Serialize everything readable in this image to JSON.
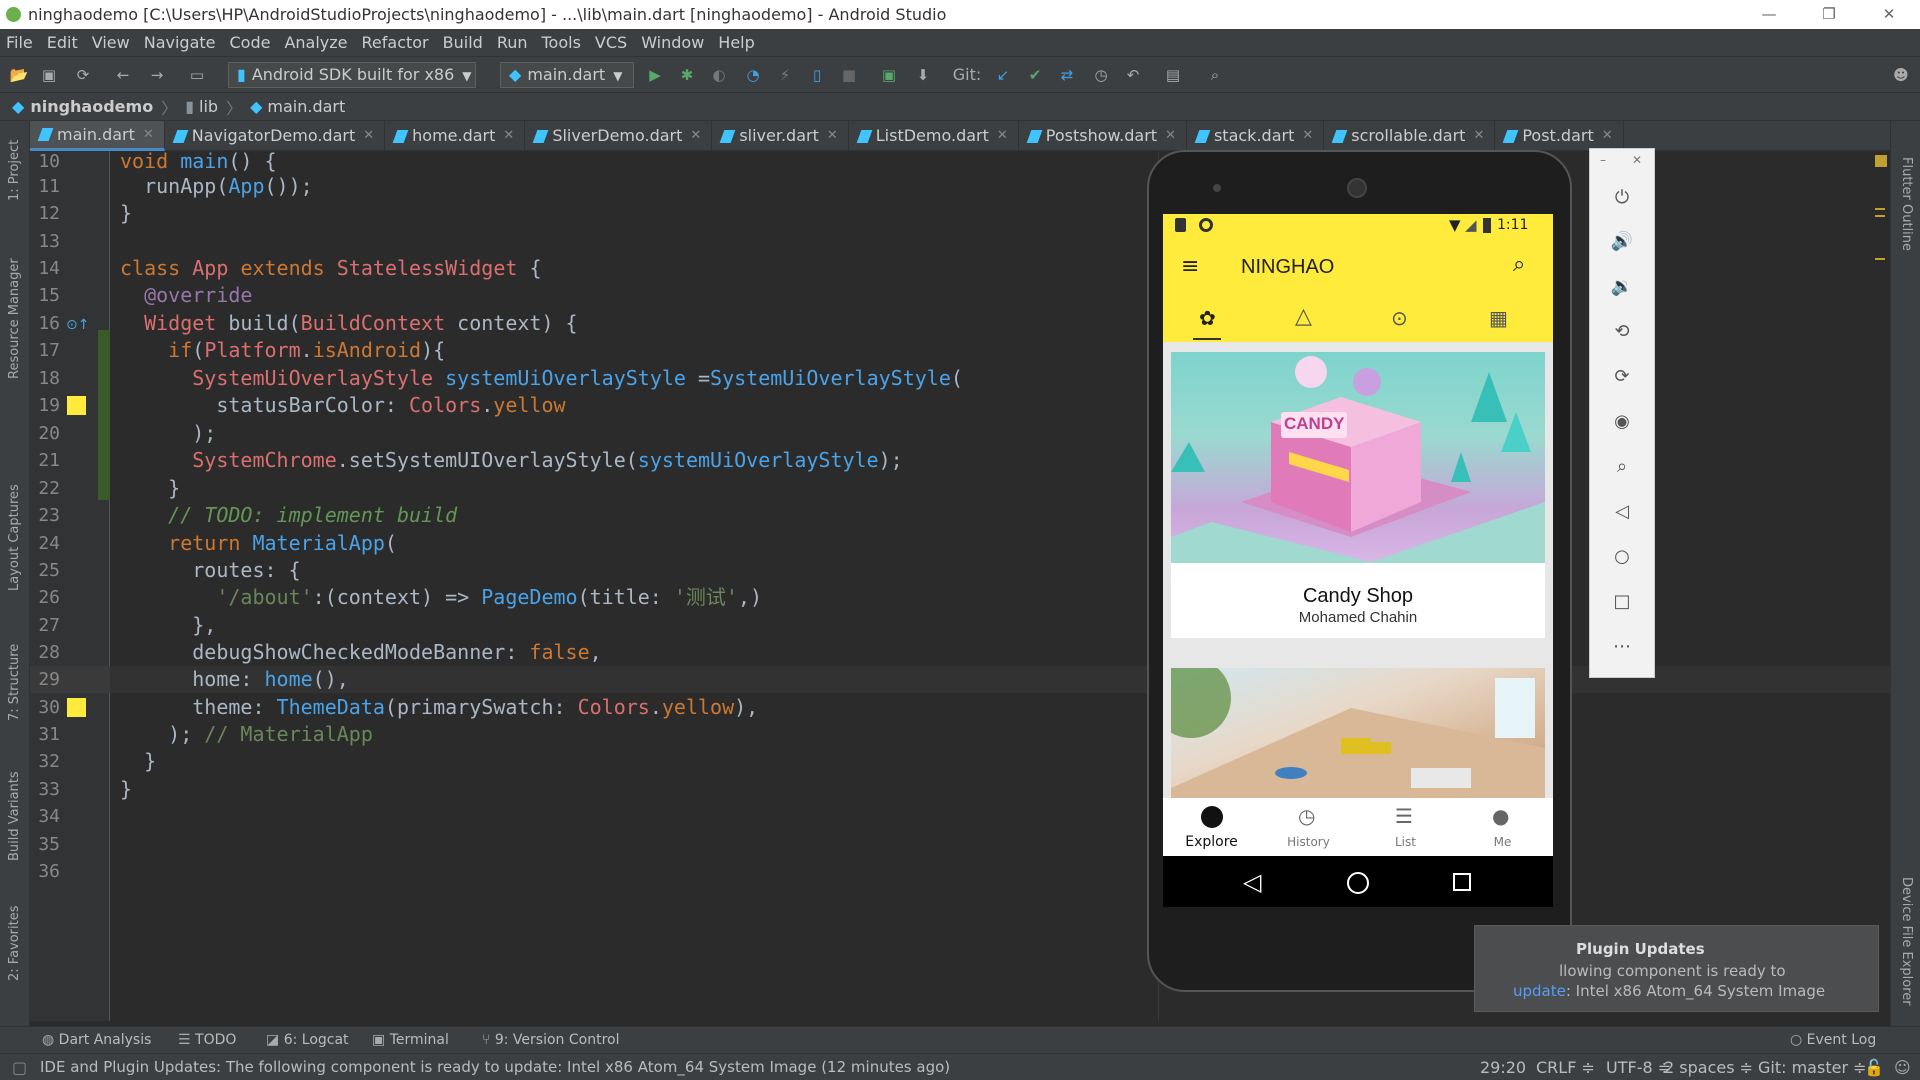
{
  "window": {
    "title": "ninghaodemo [C:\\Users\\HP\\AndroidStudioProjects\\ninghaodemo] - ...\\lib\\main.dart [ninghaodemo] - Android Studio",
    "minimize": "—",
    "maximize": "❐",
    "close": "✕"
  },
  "menu": [
    "File",
    "Edit",
    "View",
    "Navigate",
    "Code",
    "Analyze",
    "Refactor",
    "Build",
    "Run",
    "Tools",
    "VCS",
    "Window",
    "Help"
  ],
  "toolbar": {
    "device": "Android SDK built for x86",
    "run_config": "main.dart",
    "git_label": "Git:"
  },
  "breadcrumb": [
    "ninghaodemo",
    "lib",
    "main.dart"
  ],
  "tabs": [
    "main.dart",
    "NavigatorDemo.dart",
    "home.dart",
    "SliverDemo.dart",
    "sliver.dart",
    "ListDemo.dart",
    "Postshow.dart",
    "stack.dart",
    "scrollable.dart",
    "Post.dart"
  ],
  "left_tools": [
    "1: Project",
    "Resource Manager",
    "Layout Captures",
    "7: Structure",
    "Build Variants",
    "2: Favorites"
  ],
  "right_tools": [
    "Flutter Outline",
    "Device File Explorer"
  ],
  "code_lines": [
    {
      "n": "10",
      "text": "void main() {"
    },
    {
      "n": "11",
      "text": "  runApp(App());"
    },
    {
      "n": "12",
      "text": "}"
    },
    {
      "n": "13",
      "text": ""
    },
    {
      "n": "14",
      "text": "class App extends StatelessWidget {"
    },
    {
      "n": "15",
      "text": "  @override"
    },
    {
      "n": "16",
      "text": "  Widget build(BuildContext context) {"
    },
    {
      "n": "17",
      "text": "    if(Platform.isAndroid){"
    },
    {
      "n": "18",
      "text": "      SystemUiOverlayStyle systemUiOverlayStyle =SystemUiOverlayStyle("
    },
    {
      "n": "19",
      "text": "        statusBarColor: Colors.yellow"
    },
    {
      "n": "20",
      "text": "      );"
    },
    {
      "n": "21",
      "text": "      SystemChrome.setSystemUIOverlayStyle(systemUiOverlayStyle);"
    },
    {
      "n": "22",
      "text": "    }"
    },
    {
      "n": "23",
      "text": "    // TODO: implement build"
    },
    {
      "n": "24",
      "text": "    return MaterialApp("
    },
    {
      "n": "25",
      "text": "      routes: {"
    },
    {
      "n": "26",
      "text": "        '/about':(context) => PageDemo(title: '测试',)"
    },
    {
      "n": "27",
      "text": "      },"
    },
    {
      "n": "28",
      "text": "      debugShowCheckedModeBanner: false,"
    },
    {
      "n": "29",
      "text": "      home: home(),"
    },
    {
      "n": "30",
      "text": "      theme: ThemeData(primarySwatch: Colors.yellow),"
    },
    {
      "n": "31",
      "text": "    ); // MaterialApp"
    },
    {
      "n": "32",
      "text": "  }"
    },
    {
      "n": "33",
      "text": "}"
    },
    {
      "n": "34",
      "text": ""
    },
    {
      "n": "35",
      "text": ""
    },
    {
      "n": "36",
      "text": ""
    }
  ],
  "phone": {
    "time": "1:11",
    "app_title": "NINGHAO",
    "card_title": "Candy Shop",
    "card_author": "Mohamed Chahin",
    "shop_sign": "CANDY",
    "nav": [
      "Explore",
      "History",
      "List",
      "Me"
    ]
  },
  "notification": {
    "title": "Plugin Updates",
    "body": "llowing component is ready to",
    "link": "update",
    "rest": ": Intel x86 Atom_64 System Image"
  },
  "bottom_tools": [
    "Dart Analysis",
    "TODO",
    "6: Logcat",
    "Terminal",
    "9: Version Control"
  ],
  "event_log": "Event Log",
  "status": {
    "message": "IDE and Plugin Updates: The following component is ready to update: Intel x86 Atom_64 System Image (12 minutes ago)",
    "position": "29:20",
    "line_sep": "CRLF ≑",
    "encoding": "UTF-8 ≑",
    "indent": "2 spaces ≑",
    "branch": "Git: master ≑"
  },
  "colors": {
    "accent": "#4a88c7",
    "swatch": "#ffeb3b",
    "phone_bar": "#ffeb3b"
  }
}
